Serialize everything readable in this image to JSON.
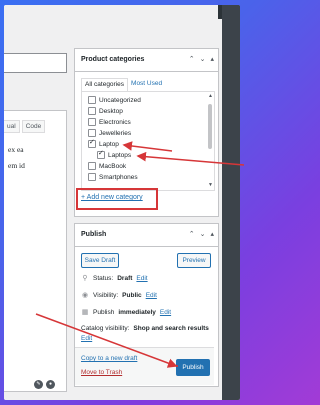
{
  "editor": {
    "tabs": [
      "ual",
      "Code"
    ],
    "text_line1": "ex ea",
    "text_line2": "em id"
  },
  "categories": {
    "title": "Product categories",
    "ctrl_up": "⌃",
    "ctrl_down": "⌄",
    "ctrl_toggle": "▴",
    "tab_all": "All categories",
    "tab_used": "Most Used",
    "items": [
      {
        "label": "Uncategorized",
        "checked": false
      },
      {
        "label": "Desktop",
        "checked": false
      },
      {
        "label": "Electronics",
        "checked": false
      },
      {
        "label": "Jewelleries",
        "checked": false
      },
      {
        "label": "Laptop",
        "checked": true
      },
      {
        "label": "Laptops",
        "checked": true
      },
      {
        "label": "MacBook",
        "checked": false
      },
      {
        "label": "Smartphones",
        "checked": false
      }
    ],
    "add_new": "+ Add new category"
  },
  "publish": {
    "title": "Publish",
    "save_draft": "Save Draft",
    "preview": "Preview",
    "status_label": "Status:",
    "status_value": "Draft",
    "visibility_label": "Visibility:",
    "visibility_value": "Public",
    "publish_label": "Publish",
    "publish_value": "immediately",
    "edit": "Edit",
    "catalog_label": "Catalog visibility:",
    "catalog_value": "Shop and search results",
    "copy_draft": "Copy to a new draft",
    "move_trash": "Move to Trash",
    "publish_button": "Publish"
  },
  "colors": {
    "accent": "#2271b1",
    "annotation": "#d63638"
  }
}
